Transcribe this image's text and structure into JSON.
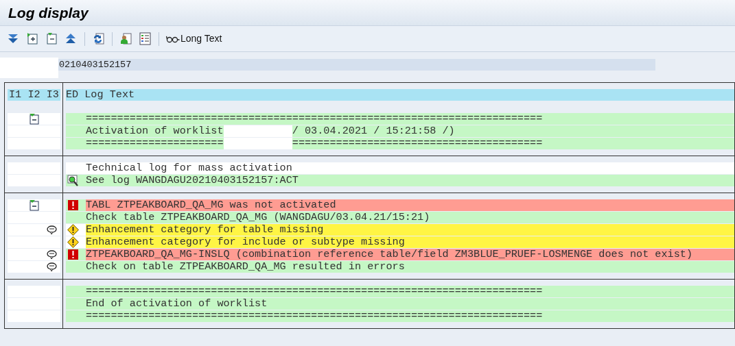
{
  "window": {
    "title": "Log display"
  },
  "toolbar": {
    "icons": [
      {
        "kind": "expand"
      },
      {
        "kind": "expand-doc"
      },
      {
        "kind": "collapse-doc"
      },
      {
        "kind": "collapse"
      },
      {
        "kind": "refresh",
        "separator_before": true
      },
      {
        "kind": "person",
        "separator_before": true
      },
      {
        "kind": "list"
      }
    ],
    "long_text_button": {
      "label": "Long Text"
    }
  },
  "header_field": {
    "redacted": true,
    "value": "0210403152157"
  },
  "table": {
    "columns": [
      "I1",
      "I2",
      "I3",
      "ED",
      "Log Text"
    ],
    "groups": [
      {
        "rows": [
          {
            "text": "=========================================================================",
            "kind": "ok",
            "i2_icon": {
              "kind": "document"
            }
          },
          {
            "text": "Activation of worklist",
            "redacted": true,
            "text_after": "/ 03.04.2021 / 15:21:58 /)",
            "kind": "ok"
          },
          {
            "text": "======================",
            "redacted": true,
            "text_after": "========================================",
            "kind": "ok"
          }
        ]
      },
      {
        "rows": [
          {
            "text": "Technical log for mass activation",
            "kind": "plain"
          },
          {
            "text": "See log WANGDAGU20210403152157:ACT",
            "kind": "ok",
            "status_icon": {
              "kind": "detail"
            }
          }
        ]
      },
      {
        "rows": [
          {
            "text": "TABL ZTPEAKBOARD_QA_MG was not activated",
            "kind": "error",
            "status_icon": {
              "kind": "error"
            },
            "i2_icon": {
              "kind": "document"
            }
          },
          {
            "text": "Check table ZTPEAKBOARD_QA_MG (WANGDAGU/03.04.21/15:21)",
            "kind": "ok"
          },
          {
            "text": "Enhancement category for table missing",
            "kind": "warning",
            "status_icon": {
              "kind": "warning"
            },
            "i3_icon": {
              "kind": "bubble"
            }
          },
          {
            "text": "Enhancement category for include or subtype missing",
            "kind": "warning",
            "status_icon": {
              "kind": "warning"
            }
          },
          {
            "text": "ZTPEAKBOARD_QA_MG-INSLQ (combination reference table/field ZM3BLUE_PRUEF-LOSMENGE does not exist)",
            "kind": "error",
            "status_icon": {
              "kind": "error"
            },
            "i3_icon": {
              "kind": "bubble"
            }
          },
          {
            "text": "Check on table ZTPEAKBOARD_QA_MG resulted in errors",
            "kind": "ok",
            "i3_icon": {
              "kind": "bubble"
            }
          }
        ]
      },
      {
        "rows": [
          {
            "text": "=========================================================================",
            "kind": "ok"
          },
          {
            "text": "End of activation of worklist",
            "kind": "ok"
          },
          {
            "text": "=========================================================================",
            "kind": "ok"
          }
        ]
      }
    ]
  }
}
